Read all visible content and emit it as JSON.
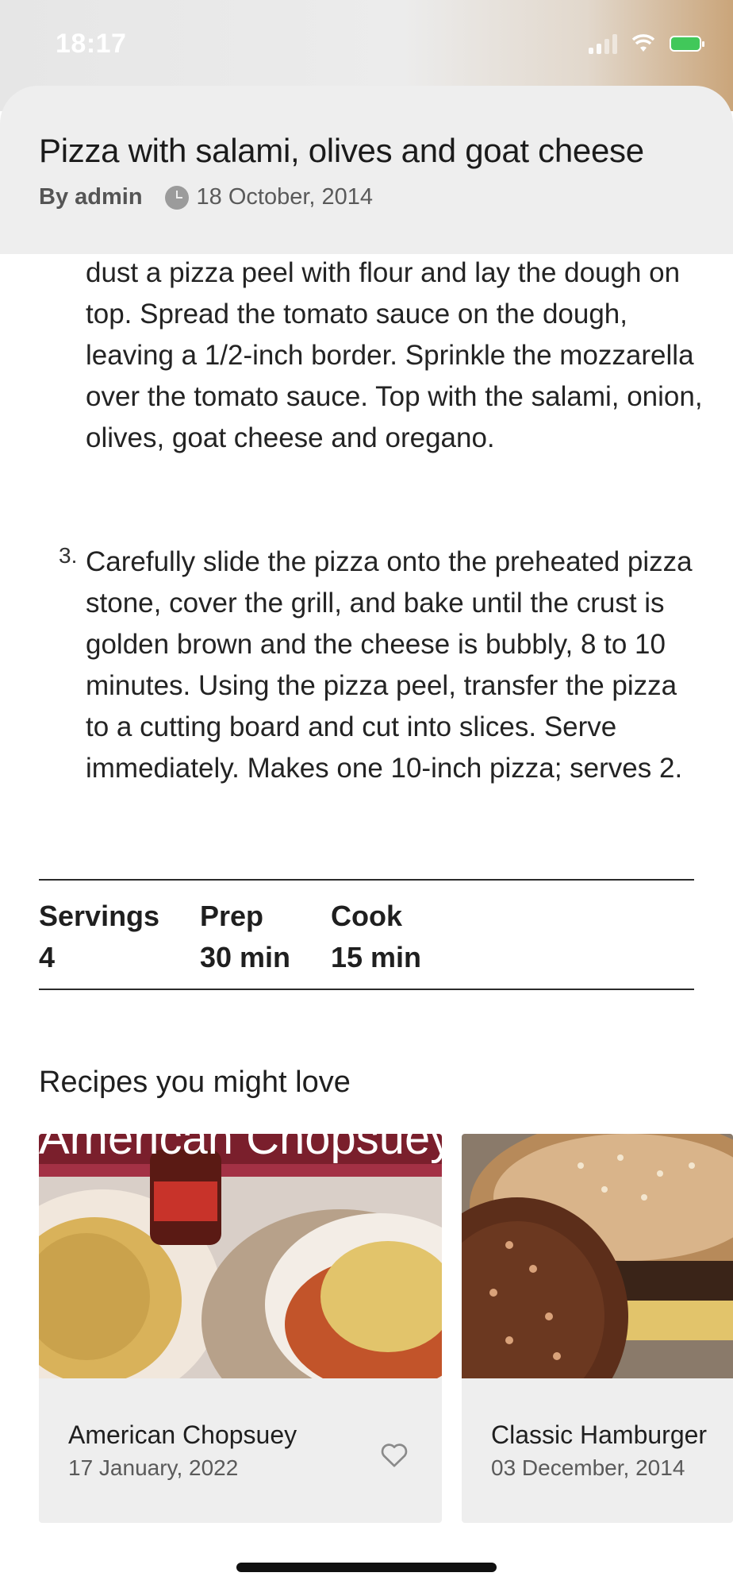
{
  "status": {
    "time": "18:17"
  },
  "recipe": {
    "title": "Pizza with salami, olives and goat cheese",
    "author": "By admin",
    "date": "18 October, 2014"
  },
  "steps": {
    "step2_continued": "dust a pizza peel with flour and lay the dough on top. Spread the tomato sauce on the dough, leaving a 1/2-inch border. Sprinkle the mozzarella over the tomato sauce. Top with the salami, onion, olives, goat cheese and oregano.",
    "step3_number": "3.",
    "step3": "Carefully slide the pizza onto the preheated pizza stone, cover the grill, and bake until the crust is golden brown and the cheese is bubbly, 8 to 10 minutes. Using the pizza peel, transfer the pizza to a cutting board and cut into slices. Serve immediately. Makes one 10-inch pizza; serves 2."
  },
  "stats": {
    "servings_label": "Servings",
    "servings_value": "4",
    "prep_label": "Prep",
    "prep_value": "30 min",
    "cook_label": "Cook",
    "cook_value": "15 min"
  },
  "related": {
    "title": "Recipes you might love",
    "cards": [
      {
        "title": "American Chopsuey",
        "date": "17 January, 2022",
        "image_caption": "American Chopsuey",
        "icon": "heart-outline"
      },
      {
        "title": "Classic Hamburger",
        "date": "03 December, 2014"
      }
    ]
  },
  "colors": {
    "header_bg": "#eeeeee",
    "card_bg": "#eeeeee",
    "text": "#1f1f1f",
    "battery": "#41c85a"
  }
}
